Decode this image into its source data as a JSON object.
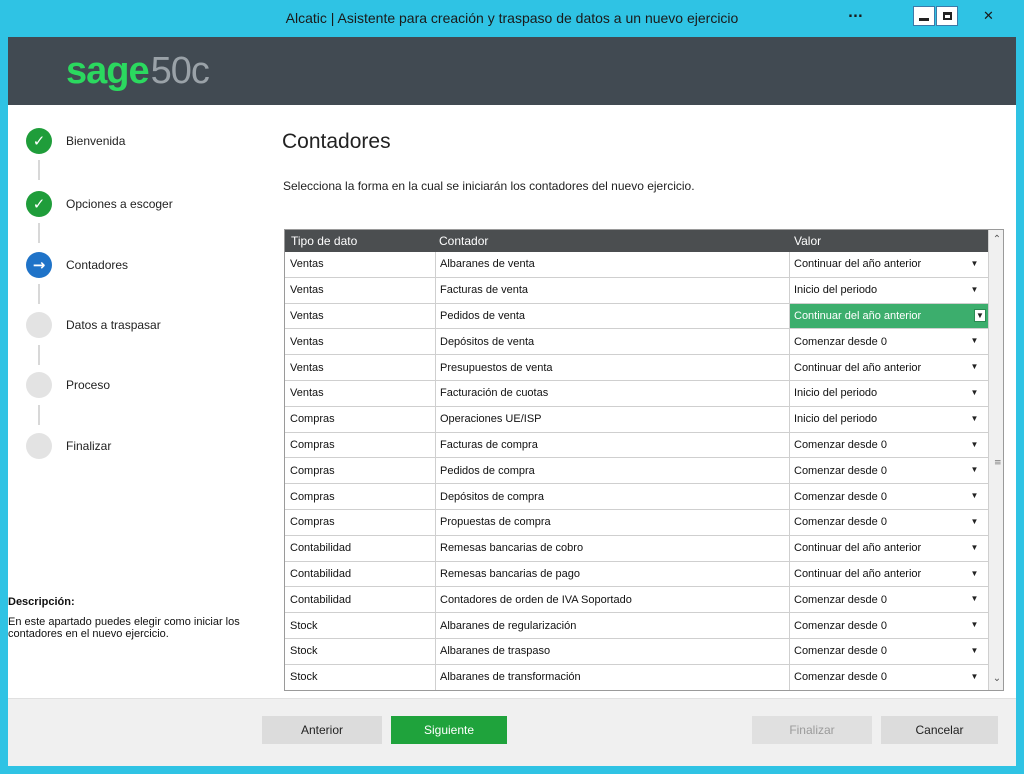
{
  "window": {
    "title": "Alcatic | Asistente para creación y traspaso de datos a un nuevo ejercicio",
    "extra": "..."
  },
  "header": {
    "logo_main": "sage",
    "logo_suffix": "50c"
  },
  "steps": [
    {
      "label": "Bienvenida",
      "state": "done",
      "icon": "check-icon"
    },
    {
      "label": "Opciones a escoger",
      "state": "done",
      "icon": "check-icon"
    },
    {
      "label": "Contadores",
      "state": "current",
      "icon": "arrow-right-icon"
    },
    {
      "label": "Datos a traspasar",
      "state": "pending",
      "icon": "empty-circle-icon"
    },
    {
      "label": "Proceso",
      "state": "pending",
      "icon": "empty-circle-icon"
    },
    {
      "label": "Finalizar",
      "state": "pending",
      "icon": "empty-circle-icon"
    }
  ],
  "description": {
    "title": "Descripción:",
    "text": "En este apartado puedes elegir como iniciar los contadores en el nuevo ejercicio."
  },
  "main": {
    "title": "Contadores",
    "subtitle": "Selecciona la forma en la cual se iniciarán los contadores del nuevo ejercicio."
  },
  "grid": {
    "columns": [
      "Tipo de dato",
      "Contador",
      "Valor"
    ],
    "rows": [
      {
        "tipo": "Ventas",
        "contador": "Albaranes de venta",
        "valor": "Continuar del año anterior"
      },
      {
        "tipo": "Ventas",
        "contador": "Facturas de venta",
        "valor": "Inicio del periodo"
      },
      {
        "tipo": "Ventas",
        "contador": "Pedidos de venta",
        "valor": "Continuar del año anterior",
        "selected": true
      },
      {
        "tipo": "Ventas",
        "contador": "Depósitos de venta",
        "valor": "Comenzar desde 0"
      },
      {
        "tipo": "Ventas",
        "contador": "Presupuestos de venta",
        "valor": "Continuar del año anterior"
      },
      {
        "tipo": "Ventas",
        "contador": "Facturación de cuotas",
        "valor": "Inicio del periodo"
      },
      {
        "tipo": "Compras",
        "contador": "Operaciones UE/ISP",
        "valor": "Inicio del periodo"
      },
      {
        "tipo": "Compras",
        "contador": "Facturas de compra",
        "valor": "Comenzar desde 0"
      },
      {
        "tipo": "Compras",
        "contador": "Pedidos de compra",
        "valor": "Comenzar desde 0"
      },
      {
        "tipo": "Compras",
        "contador": "Depósitos de compra",
        "valor": "Comenzar desde 0"
      },
      {
        "tipo": "Compras",
        "contador": "Propuestas de compra",
        "valor": "Comenzar desde 0"
      },
      {
        "tipo": "Contabilidad",
        "contador": "Remesas bancarias de cobro",
        "valor": "Continuar del año anterior"
      },
      {
        "tipo": "Contabilidad",
        "contador": "Remesas bancarias de pago",
        "valor": "Continuar del año anterior"
      },
      {
        "tipo": "Contabilidad",
        "contador": "Contadores de orden de IVA Soportado",
        "valor": "Comenzar desde 0"
      },
      {
        "tipo": "Stock",
        "contador": "Albaranes de regularización",
        "valor": "Comenzar desde 0"
      },
      {
        "tipo": "Stock",
        "contador": "Albaranes de traspaso",
        "valor": "Comenzar desde 0"
      },
      {
        "tipo": "Stock",
        "contador": "Albaranes de transformación",
        "valor": "Comenzar desde 0"
      }
    ]
  },
  "footer": {
    "prev_label": "Anterior",
    "next_label": "Siguiente",
    "finish_label": "Finalizar",
    "cancel_label": "Cancelar"
  },
  "colors": {
    "titlebar": "#2fc3e4",
    "header": "#414a52",
    "brand_green": "#2bd95f",
    "step_done": "#1f9d3a",
    "step_current": "#1f73c8",
    "selected_cell": "#3cae6d",
    "next_button": "#1fa33c"
  }
}
